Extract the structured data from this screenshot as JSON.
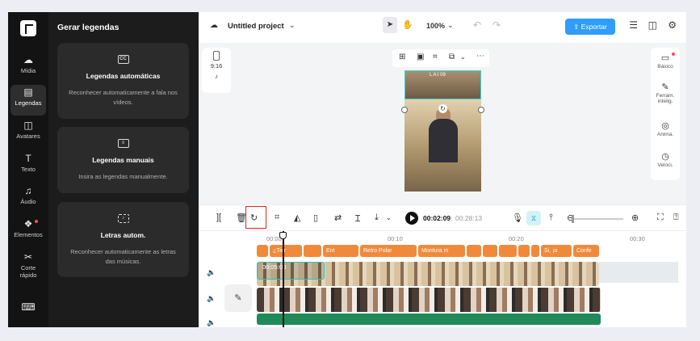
{
  "sidebar": {
    "items": [
      {
        "label": "Mídia",
        "icon": "cloud-upload-icon",
        "glyph": "☁"
      },
      {
        "label": "Legendas",
        "icon": "captions-icon",
        "glyph": "▤"
      },
      {
        "label": "Avatares",
        "icon": "avatar-icon",
        "glyph": "◫"
      },
      {
        "label": "Texto",
        "icon": "text-icon",
        "glyph": "T"
      },
      {
        "label": "Áudio",
        "icon": "music-note-icon",
        "glyph": "♫"
      },
      {
        "label": "Elementos",
        "icon": "elements-icon",
        "glyph": "❖"
      },
      {
        "label": "Corte",
        "label2": "rápido",
        "icon": "quick-cut-icon",
        "glyph": "✂"
      },
      {
        "icon": "keyboard-icon",
        "glyph": "⌨"
      }
    ]
  },
  "panel": {
    "title": "Gerar legendas",
    "cards": [
      {
        "title": "Legendas automáticas",
        "desc": "Reconhecer automaticamente a fala nos vídeos.",
        "icon": "cc-icon"
      },
      {
        "title": "Legendas manuais",
        "desc": "Insira as legendas manualmente.",
        "icon": "subtitle-icon"
      },
      {
        "title": "Letras autom.",
        "desc": "Reconhecer automaticamente as letras das músicas.",
        "icon": "lyrics-scan-icon"
      }
    ]
  },
  "topbar": {
    "project_title": "Untitled project",
    "zoom": "100%",
    "export_label": "Exportar"
  },
  "canvas": {
    "ratio": "9:16",
    "preview_caption": "L A I 09"
  },
  "rightbar": {
    "items": [
      {
        "label": "Básico",
        "icon": "basic-icon"
      },
      {
        "label": "Ferram.",
        "label2": "intelig.",
        "icon": "magic-wand-icon"
      },
      {
        "label": "Anima.",
        "icon": "animation-icon"
      },
      {
        "label": "Veloci.",
        "icon": "speed-icon"
      }
    ]
  },
  "timeline": {
    "current_time": "00:02:09",
    "separator": "|",
    "total_time": "00:28:13",
    "ruler": [
      "00:00",
      "00:10",
      "00:20",
      "00:30"
    ],
    "clip_label": "00:05:00",
    "captions": [
      "",
      "¿Tier",
      "",
      "Ent",
      "Retro Polar",
      "Montura m",
      "",
      "",
      "",
      "",
      "",
      "Si, ¡o",
      "Confe"
    ]
  }
}
